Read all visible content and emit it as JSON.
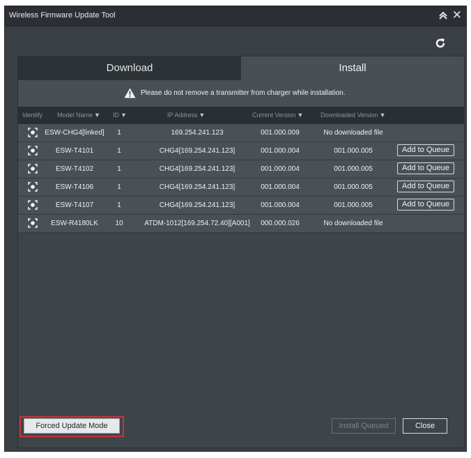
{
  "window": {
    "title": "Wireless Firmware Update Tool"
  },
  "tabs": {
    "download": "Download",
    "install": "Install",
    "active": "install"
  },
  "warning": {
    "text": "Please do not remove a transmitter from charger while installation.",
    "icon": "warning-icon"
  },
  "columns": {
    "identify": "Identify",
    "model": "Model Name",
    "id": "ID",
    "ip": "IP Address",
    "current": "Current Version",
    "downloaded": "Downloaded Version"
  },
  "rows": [
    {
      "model": "ESW-CHG4[linked]",
      "id": "1",
      "ip": "169.254.241.123",
      "current": "001.000.009",
      "downloaded": "No downloaded file",
      "action": ""
    },
    {
      "model": "ESW-T4101",
      "id": "1",
      "ip": "CHG4[169.254.241.123]",
      "current": "001.000.004",
      "downloaded": "001.000.005",
      "action": "Add to Queue"
    },
    {
      "model": "ESW-T4102",
      "id": "1",
      "ip": "CHG4[169.254.241.123]",
      "current": "001.000.004",
      "downloaded": "001.000.005",
      "action": "Add to Queue"
    },
    {
      "model": "ESW-T4106",
      "id": "1",
      "ip": "CHG4[169.254.241.123]",
      "current": "001.000.004",
      "downloaded": "001.000.005",
      "action": "Add to Queue"
    },
    {
      "model": "ESW-T4107",
      "id": "1",
      "ip": "CHG4[169.254.241.123]",
      "current": "001.000.004",
      "downloaded": "001.000.005",
      "action": "Add to Queue"
    },
    {
      "model": "ESW-R4180LK",
      "id": "10",
      "ip": "ATDM-1012[169.254.72.40][A001]",
      "current": "000.000.026",
      "downloaded": "No downloaded file",
      "action": ""
    }
  ],
  "footer": {
    "forced": "Forced Update Mode",
    "install_queued": "Install Queued",
    "close": "Close"
  },
  "colors": {
    "window_bg": "#3a4045",
    "titlebar_bg": "#2b2f33",
    "row_bg": "#4a5156",
    "highlight_outline": "#c8353b"
  }
}
